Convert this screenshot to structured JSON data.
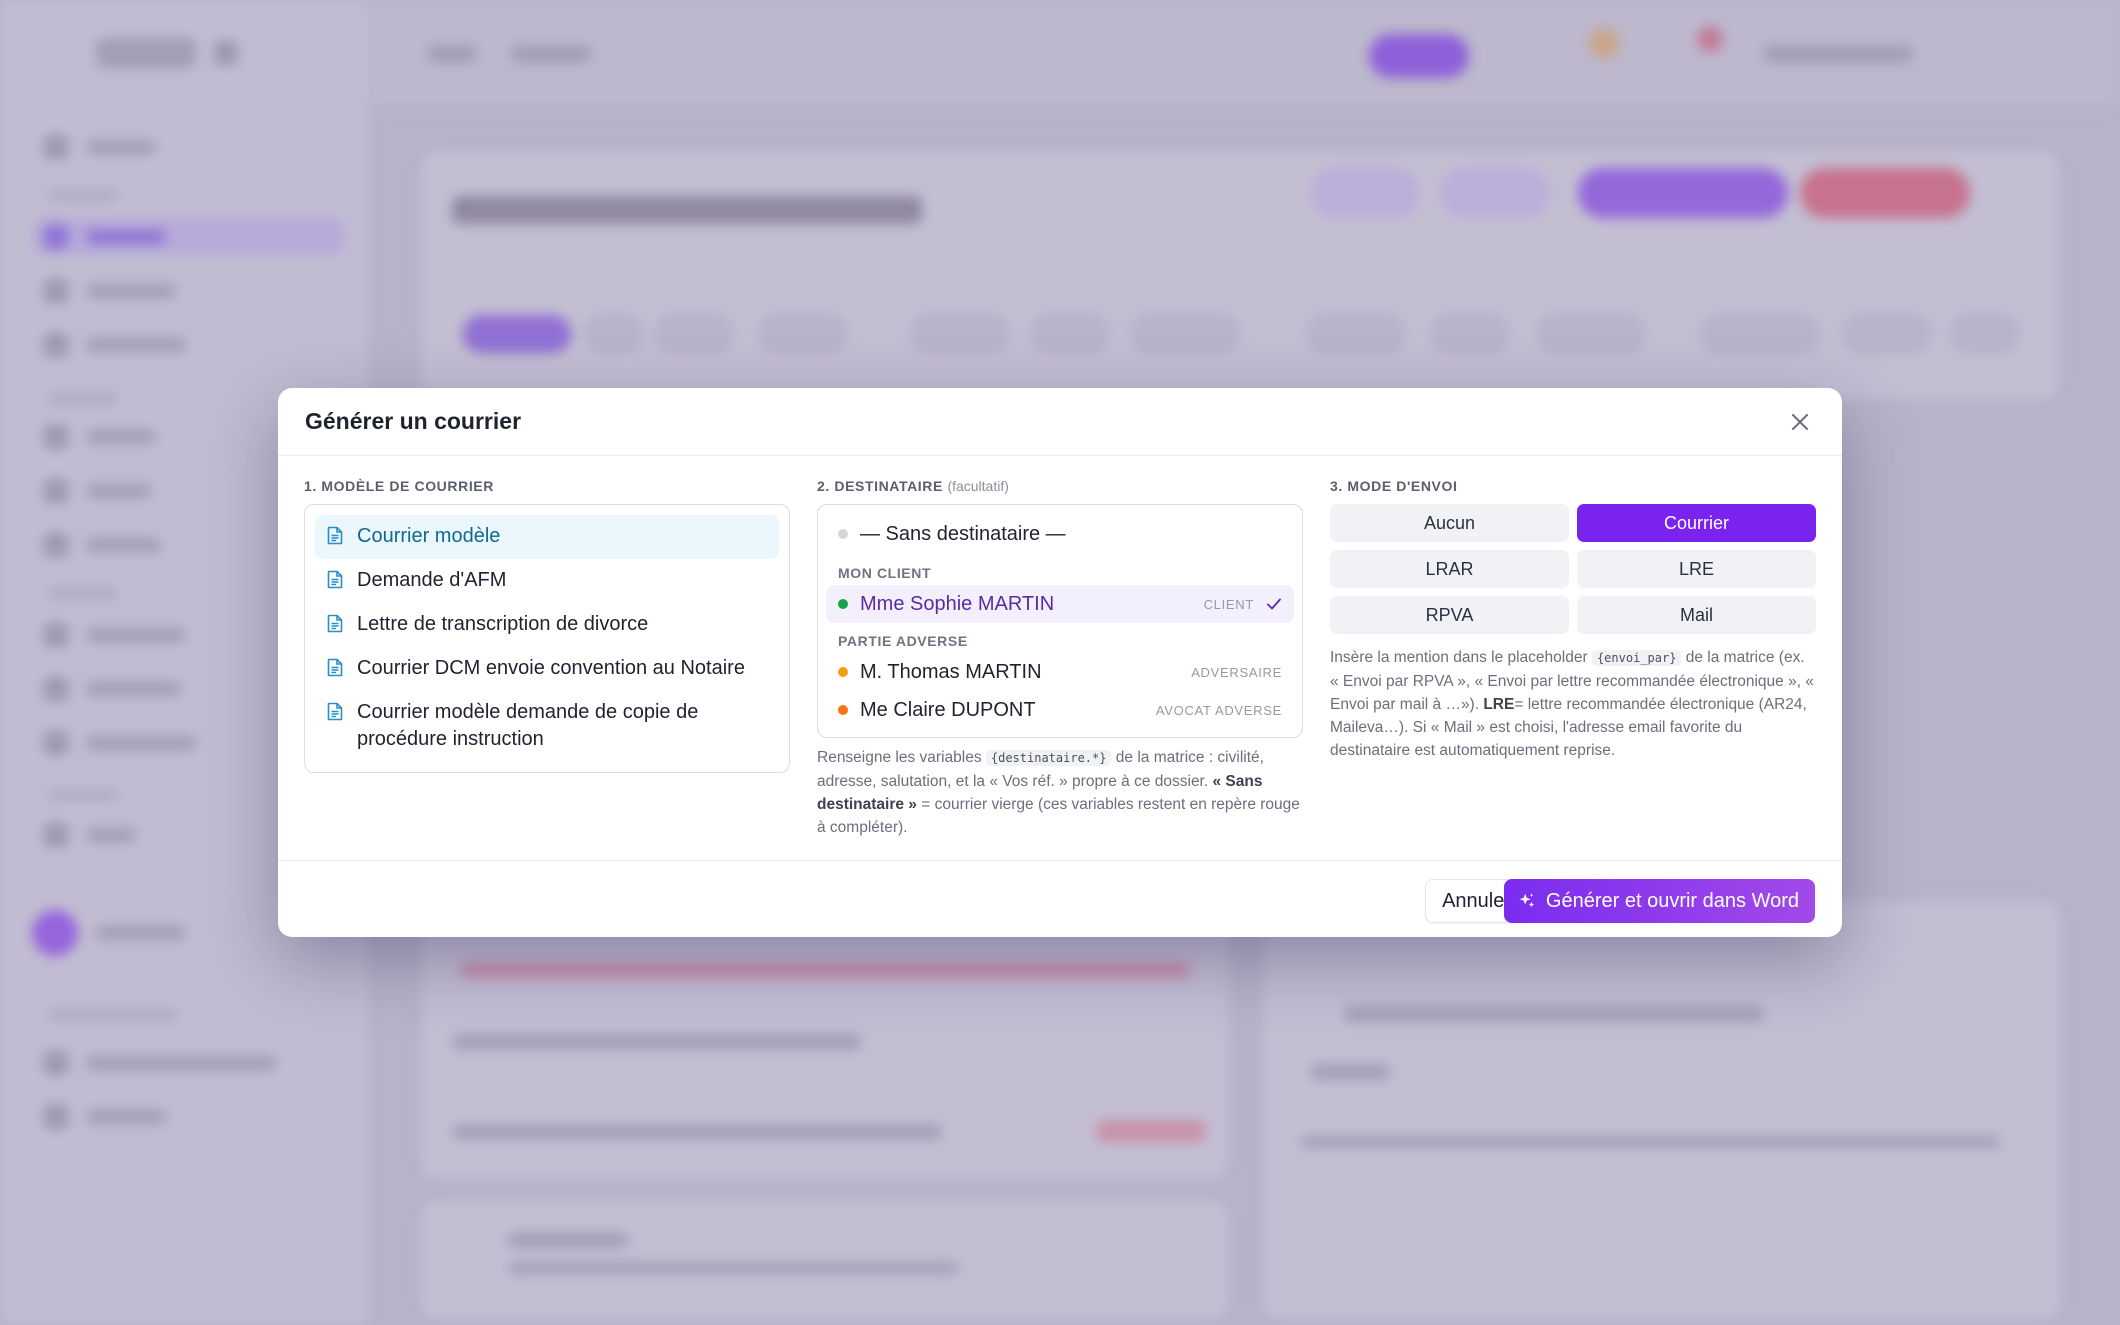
{
  "modal": {
    "title": "Générer un courrier",
    "close_icon": "close-icon"
  },
  "templates": {
    "label": "1. Modèle de courrier",
    "items": [
      {
        "label": "Courrier modèle",
        "selected": true
      },
      {
        "label": "Demande d'AFM",
        "selected": false
      },
      {
        "label": "Lettre de transcription de divorce",
        "selected": false
      },
      {
        "label": "Courrier DCM envoie convention au Notaire",
        "selected": false
      },
      {
        "label": "Courrier modèle demande de copie de procédure instruction",
        "selected": false
      }
    ],
    "icon": "document-icon"
  },
  "recipient": {
    "label": "2. Destinataire",
    "optional": "(facultatif)",
    "none_option": "— Sans destinataire —",
    "groups": {
      "client_label": "Mon client",
      "adverse_label": "Partie adverse"
    },
    "items": [
      {
        "name": "Mme Sophie MARTIN",
        "role": "Client",
        "dot_color": "#16a34a",
        "selected": true
      },
      {
        "name": "M. Thomas MARTIN",
        "role": "Adversaire",
        "dot_color": "#f59e0b",
        "selected": false
      },
      {
        "name": "Me Claire DUPONT",
        "role": "Avocat adverse",
        "dot_color": "#f97316",
        "selected": false
      }
    ],
    "help": {
      "p1": "Renseigne les variables ",
      "code": "{destinataire.*}",
      "p2": " de la matrice : civilité, adresse, salutation, et la « Vos réf. » propre à ce dossier. ",
      "bold": "« Sans destinataire »",
      "p3": " = courrier vierge (ces variables restent en repère rouge à compléter)."
    }
  },
  "mode": {
    "label": "3. Mode d'envoi",
    "options": [
      "Aucun",
      "Courrier",
      "LRAR",
      "LRE",
      "RPVA",
      "Mail"
    ],
    "active": "Courrier",
    "help": {
      "p1": "Insère la mention dans le placeholder ",
      "code": "{envoi_par}",
      "p2": " de la matrice (ex. « Envoi par RPVA », « Envoi par lettre recommandée électronique », « Envoi par mail à …»). ",
      "bold": "LRE",
      "p3": "= lettre recommandée électronique (AR24, Maileva…). Si « Mail » est choisi, l'adresse email favorite du destinataire est automatiquement reprise."
    }
  },
  "footer": {
    "cancel": "Annuler",
    "primary": "Générer et ouvrir dans Word",
    "primary_icon": "sparkles-icon"
  },
  "colors": {
    "accent": "#7a22ee",
    "selected_template_bg": "#ecf6fd",
    "selected_recipient_bg": "#f3effc"
  }
}
